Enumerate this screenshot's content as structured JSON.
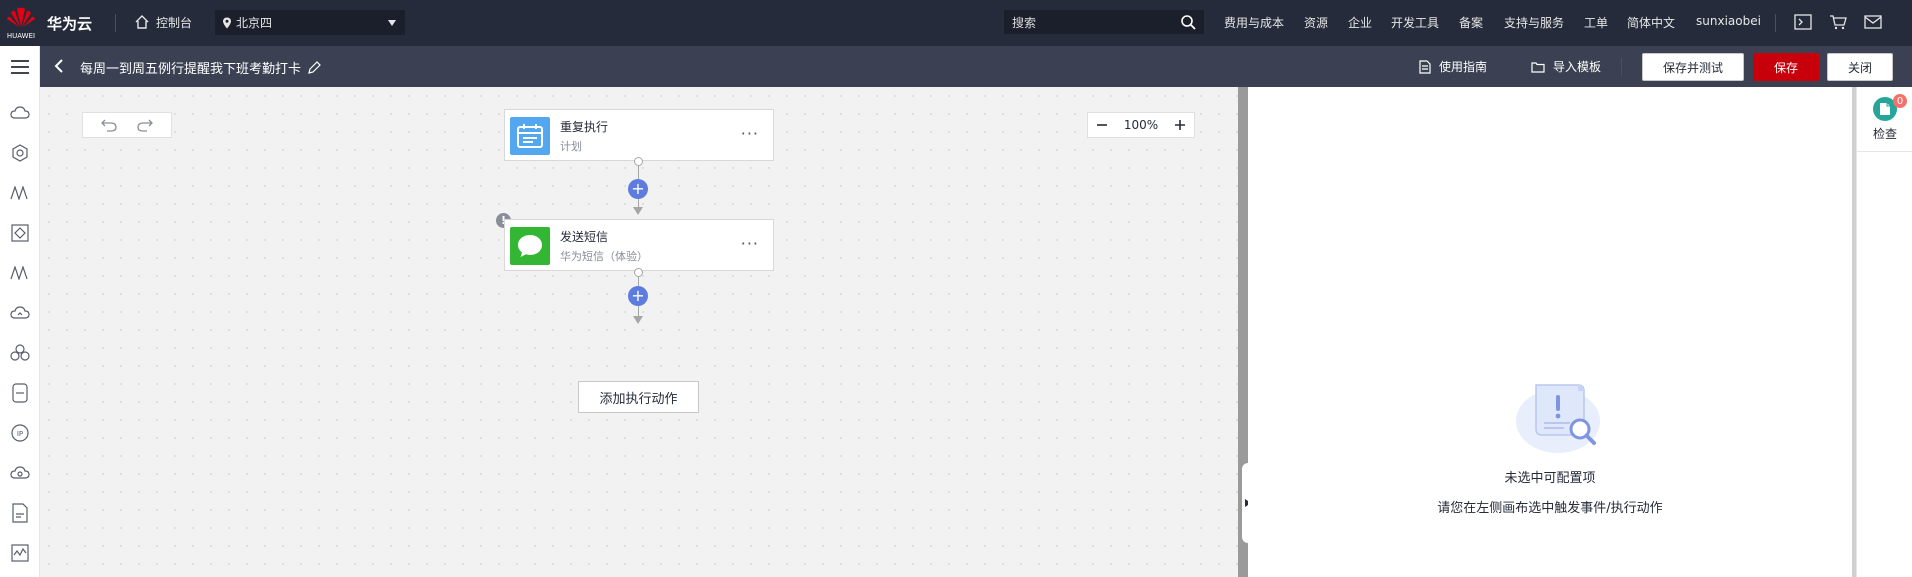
{
  "brand": {
    "logo_text": "HUAWEI",
    "name": "华为云"
  },
  "top": {
    "console_label": "控制台",
    "region": "北京四",
    "search_placeholder": "搜索",
    "nav": [
      "费用与成本",
      "资源",
      "企业",
      "开发工具",
      "备案",
      "支持与服务",
      "工单",
      "简体中文",
      "sunxiaobei"
    ]
  },
  "subbar": {
    "title": "每周一到周五例行提醒我下班考勤打卡",
    "guide": "使用指南",
    "import": "导入模板",
    "save_test": "保存并测试",
    "save": "保存",
    "close": "关闭"
  },
  "canvas": {
    "zoom": "100%",
    "nodes": [
      {
        "title": "重复执行",
        "subtitle": "计划"
      },
      {
        "title": "发送短信",
        "subtitle": "华为短信（体验）"
      }
    ],
    "warning": "!",
    "add_action": "添加执行动作"
  },
  "panel": {
    "empty_title": "未选中可配置项",
    "empty_hint": "请您在左侧画布选中触发事件/执行动作"
  },
  "check": {
    "label": "检查",
    "count": "0"
  },
  "colors": {
    "topbar": "#252b3a",
    "accent_red": "#c7000b",
    "plus_blue": "#5e7ce0",
    "check_green": "#26a69a"
  }
}
